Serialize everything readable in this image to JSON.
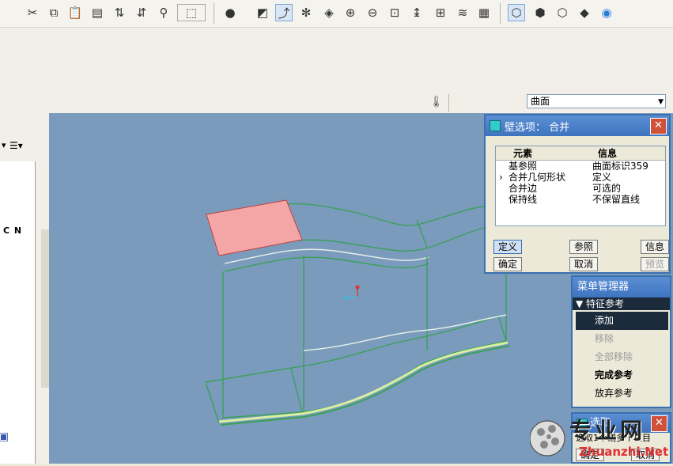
{
  "toolbar": {
    "icons": [
      "scissors-icon",
      "copy-icon",
      "paste-icon",
      "paste-special-icon",
      "regenerate-icon",
      "regen-manager-icon",
      "binoculars-icon",
      "select-box-icon",
      "shading-icon",
      "sketcher-display-icon",
      "datum-points-icon",
      "spin-center-icon",
      "orient-icon",
      "zoom-in-icon",
      "zoom-out-icon",
      "refit-icon",
      "layers-icon",
      "annotation-icon",
      "model-tree-icon",
      "isometric-icon",
      "wireframe-icon",
      "hidden-line-icon",
      "no-hidden-icon",
      "shaded-icon",
      "sphere-icon"
    ]
  },
  "filter": {
    "value": "曲面"
  },
  "left_panel": {
    "label": "C N"
  },
  "dialog": {
    "title": "壁选项： 合并",
    "columns": [
      "元素",
      "信息"
    ],
    "rows": [
      {
        "element": "基参照",
        "info": "曲面标识359",
        "marker": ""
      },
      {
        "element": "合并几何形状",
        "info": "定义",
        "marker": "›"
      },
      {
        "element": "合并边",
        "info": "可选的",
        "marker": ""
      },
      {
        "element": "保持线",
        "info": "不保留直线",
        "marker": ""
      }
    ],
    "buttons": {
      "define": "定义",
      "reference": "参照",
      "info": "信息",
      "ok": "确定",
      "cancel": "取消",
      "preview": "预览"
    }
  },
  "menu_manager": {
    "title": "菜单管理器",
    "submenu": "特征参考",
    "items": [
      {
        "label": "添加",
        "state": "highlighted"
      },
      {
        "label": "移除",
        "state": "disabled"
      },
      {
        "label": "全部移除",
        "state": "disabled"
      },
      {
        "label": "完成参考",
        "state": "bold"
      },
      {
        "label": "放弃参考",
        "state": "normal"
      }
    ]
  },
  "select_dialog": {
    "title": "选取",
    "prompt": "选取1个或多个项目",
    "ok": "确定",
    "cancel": "取消"
  },
  "watermark": {
    "cn": "专业网",
    "en": "Zhuanzhi.Net"
  },
  "colors": {
    "viewport_bg": "#7b9bbd",
    "highlight_surface": "#f4a6a6",
    "model_edges": "#3aa05a"
  }
}
